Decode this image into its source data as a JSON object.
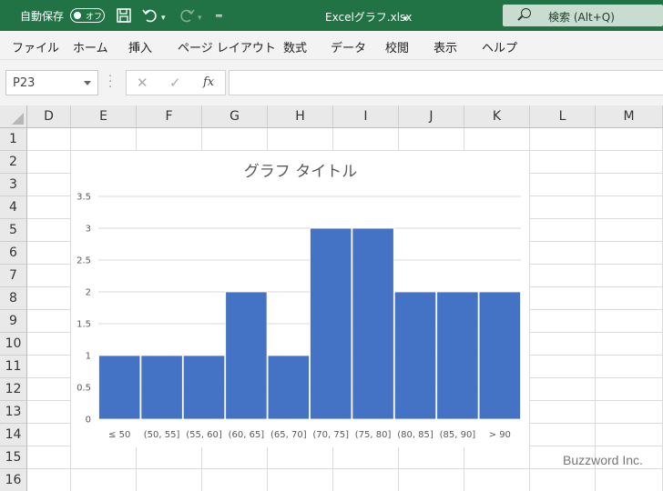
{
  "titlebar": {
    "autosave_label": "自動保存",
    "autosave_state": "オフ",
    "filename": "Excelグラフ.xlsx",
    "search_label": "検索 (Alt+Q)"
  },
  "menu": [
    "ファイル",
    "ホーム",
    "挿入",
    "ページ レイアウト",
    "数式",
    "データ",
    "校閲",
    "表示",
    "ヘルプ"
  ],
  "formula": {
    "namebox": "P23",
    "cancel": "✕",
    "enter": "✓",
    "fx": "fx",
    "value": ""
  },
  "columns": [
    "D",
    "E",
    "F",
    "G",
    "H",
    "I",
    "J",
    "K",
    "L",
    "M"
  ],
  "rows": [
    "1",
    "2",
    "3",
    "4",
    "5",
    "6",
    "7",
    "8",
    "9",
    "10",
    "11",
    "12",
    "13",
    "14",
    "15",
    "16"
  ],
  "chart_data": {
    "type": "bar",
    "title": "グラフ タイトル",
    "categories": [
      "≤ 50",
      "(50, 55]",
      "(55, 60]",
      "(60, 65]",
      "(65, 70]",
      "(70, 75]",
      "(75, 80]",
      "(80, 85]",
      "(85, 90]",
      "> 90"
    ],
    "values": [
      1,
      1,
      1,
      2,
      1,
      3,
      3,
      2,
      2,
      2
    ],
    "yticks": [
      "0",
      "0.5",
      "1",
      "1.5",
      "2",
      "2.5",
      "3",
      "3.5"
    ],
    "ylim": [
      0,
      3.5
    ],
    "grid": true,
    "bar_color": "#4472c4"
  },
  "watermark": "Buzzword Inc.",
  "colors": {
    "titlebar": "#217346",
    "bar": "#4472c4"
  }
}
